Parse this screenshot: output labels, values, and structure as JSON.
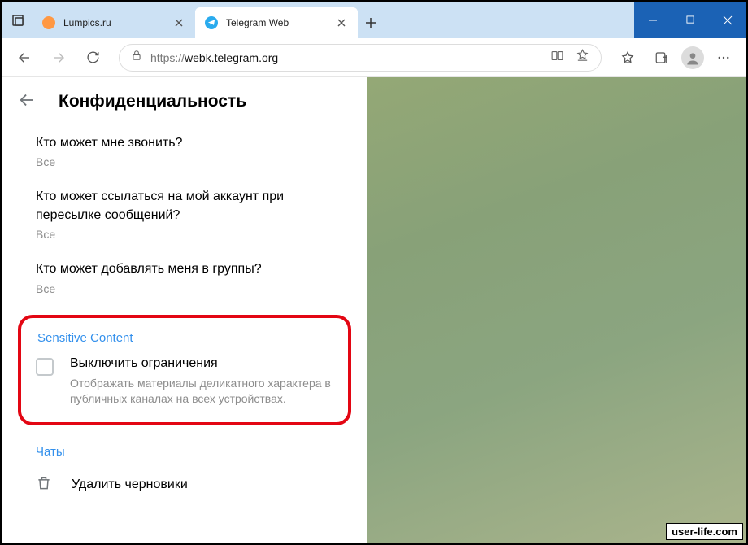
{
  "tabs": [
    {
      "title": "Lumpics.ru",
      "favicon": "orange",
      "active": false
    },
    {
      "title": "Telegram Web",
      "favicon": "telegram",
      "active": true
    }
  ],
  "address": {
    "protocol": "https://",
    "host": "webk.telegram.org"
  },
  "panel": {
    "title": "Конфиденциальность",
    "items": [
      {
        "label": "Кто может мне звонить?",
        "value": "Все"
      },
      {
        "label": "Кто может ссылаться на мой аккаунт при пересылке сообщений?",
        "value": "Все"
      },
      {
        "label": "Кто может добавлять меня в группы?",
        "value": "Все"
      }
    ],
    "sensitive": {
      "section": "Sensitive Content",
      "checkbox_label": "Выключить ограничения",
      "checkbox_desc": "Отображать материалы деликатного характера в публичных каналах на всех устройствах."
    },
    "chats_section": "Чаты",
    "delete_drafts": "Удалить черновики"
  },
  "watermark": "user-life.com"
}
